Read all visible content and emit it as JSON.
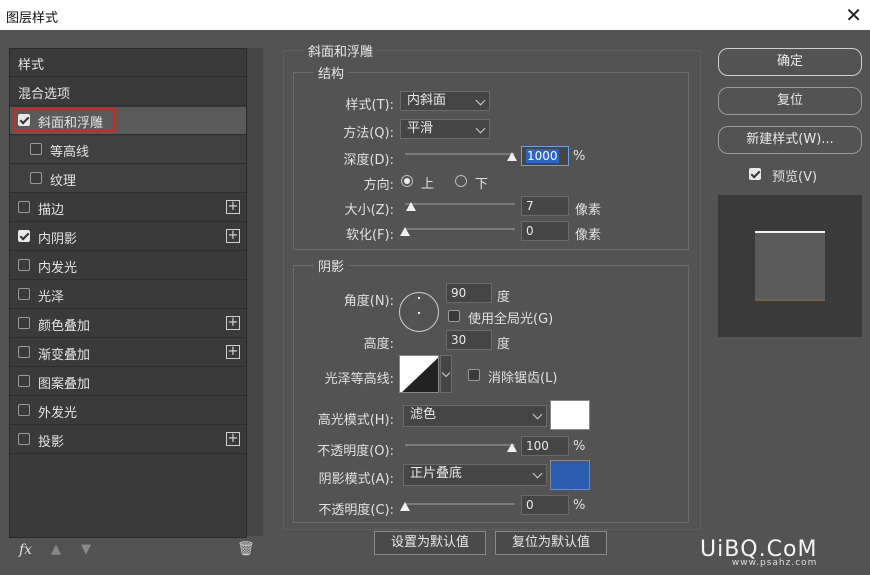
{
  "window": {
    "title": "图层样式"
  },
  "left": {
    "items": [
      {
        "label": "样式"
      },
      {
        "label": "混合选项"
      },
      {
        "label": "斜面和浮雕"
      },
      {
        "label": "等高线"
      },
      {
        "label": "纹理"
      },
      {
        "label": "描边"
      },
      {
        "label": "内阴影"
      },
      {
        "label": "内发光"
      },
      {
        "label": "光泽"
      },
      {
        "label": "颜色叠加"
      },
      {
        "label": "渐变叠加"
      },
      {
        "label": "图案叠加"
      },
      {
        "label": "外发光"
      },
      {
        "label": "投影"
      }
    ],
    "fx": "fx"
  },
  "bevel": {
    "title": "斜面和浮雕",
    "structure": {
      "title": "结构",
      "style_label": "样式(T):",
      "style_value": "内斜面",
      "technique_label": "方法(Q):",
      "technique_value": "平滑",
      "depth_label": "深度(D):",
      "depth_value": "1000",
      "depth_fraction": 1.0,
      "percent": "%",
      "direction_label": "方向:",
      "dir_up": "上",
      "dir_down": "下",
      "size_label": "大小(Z):",
      "size_value": "7",
      "size_unit": "像素",
      "soften_label": "软化(F):",
      "soften_value": "0",
      "soften_unit": "像素"
    },
    "shading": {
      "title": "阴影",
      "angle_label": "角度(N):",
      "angle_value": "90",
      "angle_unit": "度",
      "global_light": "使用全局光(G)",
      "altitude_label": "高度:",
      "altitude_value": "30",
      "altitude_unit": "度",
      "gloss_label": "光泽等高线:",
      "antialias": "消除锯齿(L)",
      "highlight_label": "高光模式(H):",
      "highlight_value": "滤色",
      "highlight_color": "#ffffff",
      "hl_opacity_label": "不透明度(O):",
      "hl_opacity_value": "100",
      "shadow_label": "阴影模式(A):",
      "shadow_value": "正片叠底",
      "shadow_color": "#2a5cb0",
      "sh_opacity_label": "不透明度(C):",
      "sh_opacity_value": "0",
      "percent": "%"
    },
    "make_default": "设置为默认值",
    "reset_default": "复位为默认值"
  },
  "buttons": {
    "ok": "确定",
    "reset": "复位",
    "new_style": "新建样式(W)...",
    "preview": "预览(V)"
  },
  "watermark": {
    "main": "UiBQ.CoM",
    "sub": "www.psahz.com"
  }
}
